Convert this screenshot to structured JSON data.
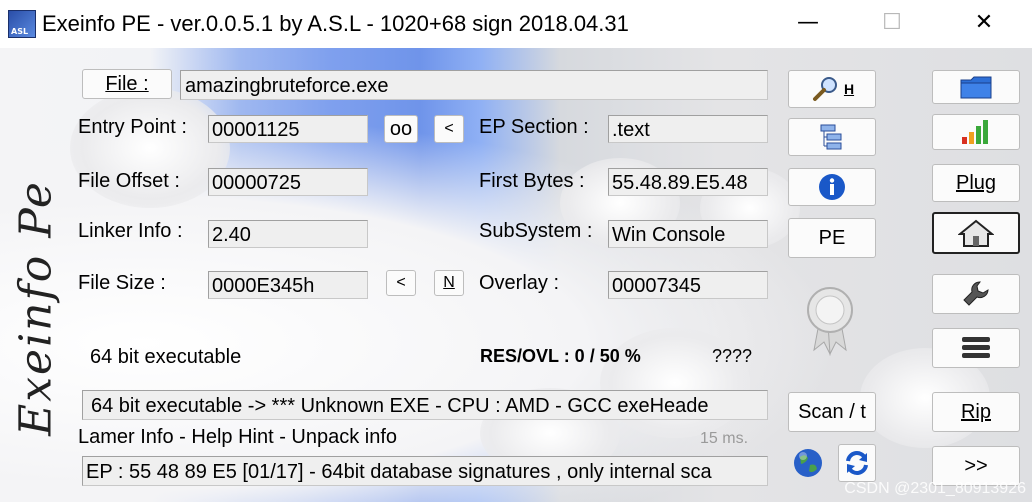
{
  "window": {
    "title": "Exeinfo PE - ver.0.0.5.1  by A.S.L -  1020+68 sign  2018.04.31",
    "icon_text": "ASL",
    "minimize": "—",
    "maximize": "☐",
    "close": "✕"
  },
  "logo_text": "Exeinfo Pe",
  "file": {
    "button_label": "File :",
    "value": "amazingbruteforce.exe"
  },
  "fields": {
    "entry_point": {
      "label": "Entry Point :",
      "value": "00001125"
    },
    "file_offset": {
      "label": "File Offset :",
      "value": "00000725"
    },
    "linker_info": {
      "label": "Linker Info :",
      "value": "2.40"
    },
    "file_size": {
      "label": "File Size :",
      "value": "0000E345h"
    },
    "ep_section": {
      "label": "EP Section :",
      "value": ".text"
    },
    "first_bytes": {
      "label": "First Bytes :",
      "value": "55.48.89.E5.48"
    },
    "subsystem": {
      "label": "SubSystem :",
      "value": "Win Console"
    },
    "overlay": {
      "label": "Overlay :",
      "value": "00007345"
    }
  },
  "small_buttons": {
    "oo": "oo",
    "lt1": "<",
    "lt2": "<",
    "n": "N"
  },
  "status": {
    "bits": "64 bit executable",
    "res_ovl": "RES/OVL : 0 / 50 %",
    "unknown": "????"
  },
  "detection": "64 bit executable -> *** Unknown EXE  - CPU : AMD  - GCC exeHeade",
  "lamer_info": "Lamer Info - Help Hint - Unpack info",
  "time_ms": "15 ms.",
  "hint": "EP : 55 48 89 E5 [01/17] - 64bit database signatures , only internal sca",
  "mid_buttons": {
    "search_h": "H",
    "pe": "PE",
    "scan": "Scan / t"
  },
  "right_buttons": {
    "plug": "Plug",
    "rip": "Rip",
    "next": ">>"
  },
  "watermark": "CSDN @2301_80913926",
  "colors": {
    "folder": "#2d6fd6",
    "info_blue": "#1a58c8",
    "bar_red": "#d83020",
    "bar_orange": "#f0a020",
    "bar_green": "#3aa83a"
  }
}
